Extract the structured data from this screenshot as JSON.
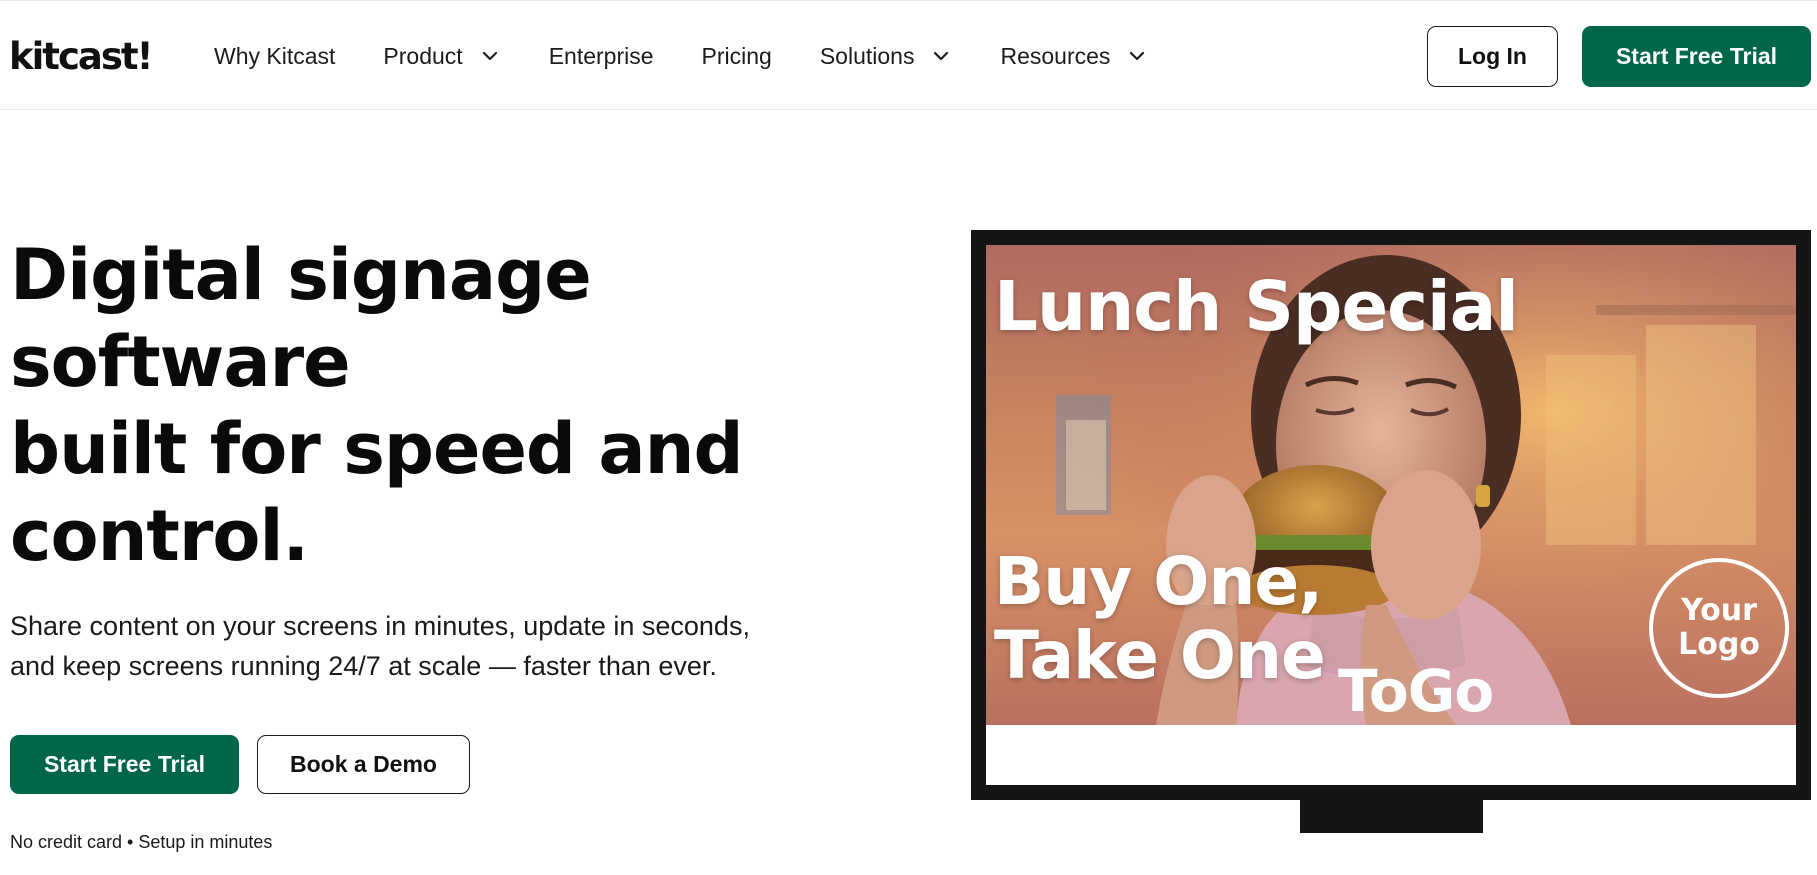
{
  "brand": {
    "name": "kitcast!"
  },
  "nav": {
    "items": [
      {
        "label": "Why Kitcast",
        "dropdown": false
      },
      {
        "label": "Product",
        "dropdown": true
      },
      {
        "label": "Enterprise",
        "dropdown": false
      },
      {
        "label": "Pricing",
        "dropdown": false
      },
      {
        "label": "Solutions",
        "dropdown": true
      },
      {
        "label": "Resources",
        "dropdown": true
      }
    ],
    "login_label": "Log In",
    "trial_label": "Start Free Trial"
  },
  "hero": {
    "title_lines": [
      "Digital signage software",
      "built for speed and control."
    ],
    "subtitle_lines": [
      "Share content on your screens in minutes, update in seconds,",
      "and keep screens running 24/7 at scale — faster than ever."
    ],
    "primary_cta": "Start Free Trial",
    "secondary_cta": "Book a Demo",
    "fine_print": "No credit card • Setup in minutes"
  },
  "signage": {
    "headline": "Lunch Special",
    "promo_line1": "Buy One,",
    "promo_line2": "Take One",
    "promo_line3": "ToGo",
    "logo_placeholder": "Your\nLogo"
  },
  "colors": {
    "brand_green": "#00664a",
    "text": "#111111",
    "monitor_frame": "#151515"
  }
}
